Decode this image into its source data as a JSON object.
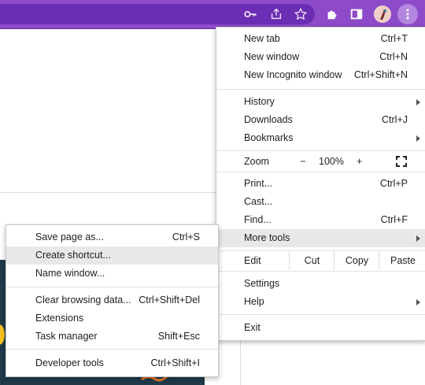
{
  "toolbar": {
    "icons": [
      "key-icon",
      "share-icon",
      "star-icon",
      "puzzle-icon",
      "side-panel-icon",
      "profile-avatar",
      "kebab-menu-icon"
    ]
  },
  "main_menu": {
    "new_tab": {
      "label": "New tab",
      "shortcut": "Ctrl+T"
    },
    "new_window": {
      "label": "New window",
      "shortcut": "Ctrl+N"
    },
    "new_incognito": {
      "label": "New Incognito window",
      "shortcut": "Ctrl+Shift+N"
    },
    "history": {
      "label": "History"
    },
    "downloads": {
      "label": "Downloads",
      "shortcut": "Ctrl+J"
    },
    "bookmarks": {
      "label": "Bookmarks"
    },
    "zoom": {
      "label": "Zoom",
      "minus": "−",
      "value": "100%",
      "plus": "+"
    },
    "print": {
      "label": "Print...",
      "shortcut": "Ctrl+P"
    },
    "cast": {
      "label": "Cast..."
    },
    "find": {
      "label": "Find...",
      "shortcut": "Ctrl+F"
    },
    "more_tools": {
      "label": "More tools"
    },
    "edit": {
      "label": "Edit",
      "cut": "Cut",
      "copy": "Copy",
      "paste": "Paste"
    },
    "settings": {
      "label": "Settings"
    },
    "help": {
      "label": "Help"
    },
    "exit": {
      "label": "Exit"
    }
  },
  "sub_menu": {
    "save_page": {
      "label": "Save page as...",
      "shortcut": "Ctrl+S"
    },
    "create_shortcut": {
      "label": "Create shortcut..."
    },
    "name_window": {
      "label": "Name window..."
    },
    "clear_data": {
      "label": "Clear browsing data...",
      "shortcut": "Ctrl+Shift+Del"
    },
    "extensions": {
      "label": "Extensions"
    },
    "task_manager": {
      "label": "Task manager",
      "shortcut": "Shift+Esc"
    },
    "dev_tools": {
      "label": "Developer tools",
      "shortcut": "Ctrl+Shift+I"
    }
  },
  "colors": {
    "toolbar": "#8e4bc9",
    "hover": "#e8e8e8",
    "page_panel": "#1f3a4a"
  }
}
